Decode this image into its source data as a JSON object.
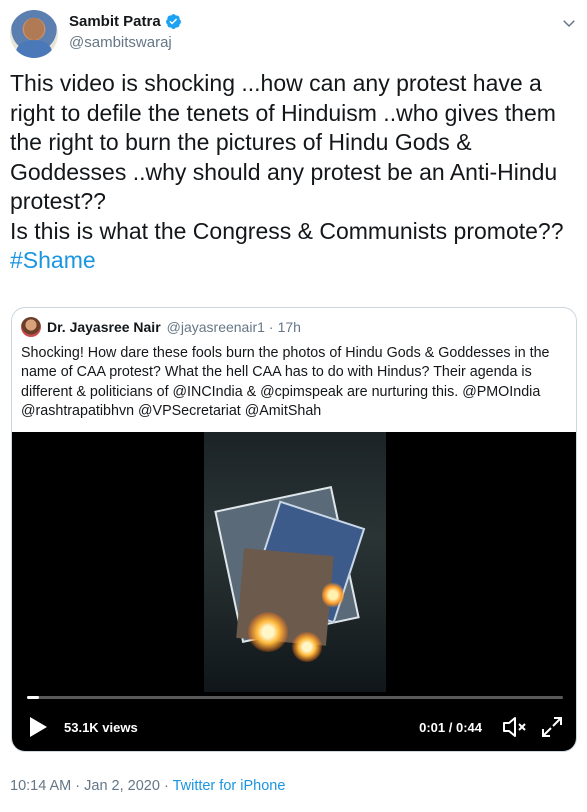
{
  "author": {
    "display_name": "Sambit Patra",
    "handle": "@sambitswaraj",
    "verified": true,
    "avatar_icon": "profile-photo-icon"
  },
  "tweet": {
    "text": "This video is shocking ...how can any protest have a right to defile the tenets of Hinduism ..who gives them the right to burn the pictures of Hindu Gods & Goddesses ..why should any protest be an Anti-Hindu protest??\nIs this is what the Congress & Communists promote?? ",
    "hashtag": "#Shame"
  },
  "quoted_tweet": {
    "display_name": "Dr. Jayasree Nair",
    "handle": "@jayasreenair1",
    "separator": "·",
    "time": "17h",
    "text": "Shocking! How dare these fools burn the photos of Hindu Gods & Goddesses in the name of CAA protest? What the hell CAA has to do with Hindus? Their agenda is different & politicians of @INCIndia & @cpimspeak are nurturing this. @PMOIndia @rashtrapatibhvn @VPSecretariat @AmitShah",
    "video": {
      "views": "53.1K views",
      "timecode": "0:01 / 0:44",
      "progress": 0.023
    }
  },
  "meta": {
    "timestamp": "10:14 AM · Jan 2, 2020",
    "separator": " · ",
    "source": "Twitter for iPhone"
  },
  "colors": {
    "link": "#1b95e0",
    "secondary_text": "#657786",
    "border": "#ccd6dd"
  }
}
